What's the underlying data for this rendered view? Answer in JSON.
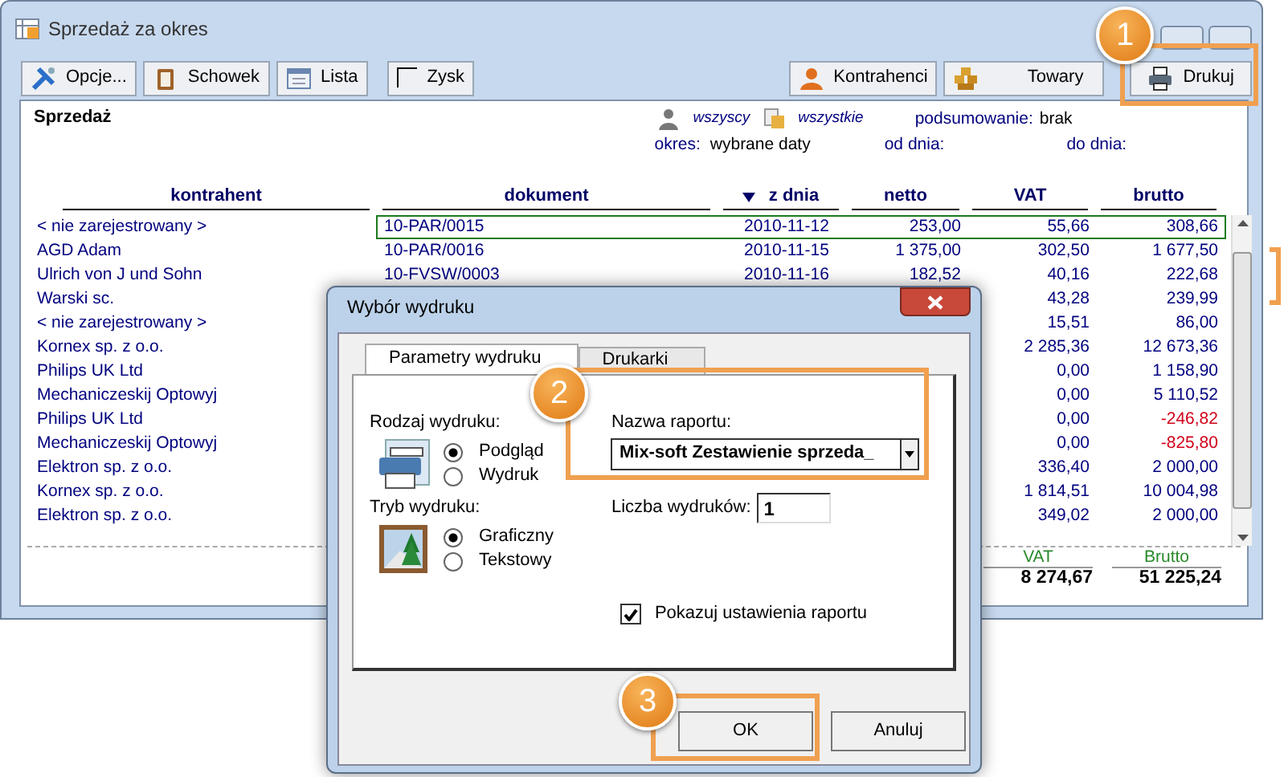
{
  "window": {
    "title": "Sprzedaż za okres"
  },
  "toolbar": {
    "left": [
      {
        "label": "Opcje..."
      },
      {
        "label": "Schowek"
      },
      {
        "label": "Lista"
      }
    ],
    "profit_checkbox": {
      "label": "Zysk",
      "checked": false
    },
    "right": [
      {
        "label": "Kontrahenci"
      },
      {
        "label": "Towary"
      },
      {
        "label": "Drukuj"
      }
    ]
  },
  "report": {
    "title": "Sprzedaż",
    "customers": "wszyscy",
    "goods": "wszystkie",
    "summary_label": "podsumowanie:",
    "summary": "brak",
    "period_label": "okres:",
    "period": "wybrane daty",
    "from_label": "od dnia:",
    "to_label": "do dnia:"
  },
  "table": {
    "columns": [
      {
        "label": "kontrahent",
        "sorted": false
      },
      {
        "label": "dokument",
        "sorted": false
      },
      {
        "label": "z dnia",
        "sorted": true
      },
      {
        "label": "netto",
        "sorted": false
      },
      {
        "label": "VAT",
        "sorted": false
      },
      {
        "label": "brutto",
        "sorted": false
      }
    ],
    "rows": [
      {
        "kontrahent": "< nie zarejestrowany >",
        "dokument": "10-PAR/0015",
        "z_dnia": "2010-11-12",
        "netto": "253,00",
        "vat": "55,66",
        "brutto": "308,66",
        "selected": true,
        "negative": false
      },
      {
        "kontrahent": "AGD Adam",
        "dokument": "10-PAR/0016",
        "z_dnia": "2010-11-15",
        "netto": "1 375,00",
        "vat": "302,50",
        "brutto": "1 677,50",
        "selected": false,
        "negative": false
      },
      {
        "kontrahent": "Ulrich von J und Sohn",
        "dokument": "10-FVSW/0003",
        "z_dnia": "2010-11-16",
        "netto": "182,52",
        "vat": "40,16",
        "brutto": "222,68",
        "selected": false,
        "negative": false
      },
      {
        "kontrahent": "Warski sc.",
        "vat": "43,28",
        "brutto": "239,99",
        "selected": false,
        "negative": false
      },
      {
        "kontrahent": "< nie zarejestrowany >",
        "vat": "15,51",
        "brutto": "86,00",
        "selected": false,
        "negative": false
      },
      {
        "kontrahent": "Kornex sp. z o.o.",
        "vat": "2 285,36",
        "brutto": "12 673,36",
        "selected": false,
        "negative": false
      },
      {
        "kontrahent": "Philips UK Ltd",
        "vat": "0,00",
        "brutto": "1 158,90",
        "selected": false,
        "negative": false
      },
      {
        "kontrahent": "Mechaniczeskij Optowyj",
        "vat": "0,00",
        "brutto": "5 110,52",
        "selected": false,
        "negative": false
      },
      {
        "kontrahent": "Philips UK Ltd",
        "vat": "0,00",
        "brutto": "-246,82",
        "selected": false,
        "negative": true
      },
      {
        "kontrahent": "Mechaniczeskij Optowyj",
        "vat": "0,00",
        "brutto": "-825,80",
        "selected": false,
        "negative": true
      },
      {
        "kontrahent": "Elektron sp. z o.o.",
        "vat": "336,40",
        "brutto": "2 000,00",
        "selected": false,
        "negative": false
      },
      {
        "kontrahent": "Kornex sp. z o.o.",
        "vat": "1 814,51",
        "brutto": "10 004,98",
        "selected": false,
        "negative": false
      },
      {
        "kontrahent": "Elektron sp. z o.o.",
        "vat": "349,02",
        "brutto": "2 000,00",
        "selected": false,
        "negative": false
      }
    ],
    "totals": [
      {
        "label": "VAT",
        "value": "8 274,67"
      },
      {
        "label": "Brutto",
        "value": "51 225,24"
      }
    ]
  },
  "dialog": {
    "title": "Wybór wydruku",
    "tabs": [
      {
        "label": "Parametry wydruku",
        "selected": true
      },
      {
        "label": "Drukarki",
        "selected": false
      }
    ],
    "print_type": {
      "label": "Rodzaj wydruku:",
      "options": [
        {
          "label": "Podgląd",
          "selected": true
        },
        {
          "label": "Wydruk",
          "selected": false
        }
      ]
    },
    "print_mode": {
      "label": "Tryb wydruku:",
      "options": [
        {
          "label": "Graficzny",
          "selected": true
        },
        {
          "label": "Tekstowy",
          "selected": false
        }
      ]
    },
    "report_name": {
      "label": "Nazwa raportu:",
      "value": "Mix-soft Zestawienie sprzeda_"
    },
    "copies": {
      "label": "Liczba wydruków:",
      "value": "1"
    },
    "show_settings": {
      "label": "Pokazuj ustawienia raportu",
      "checked": true
    },
    "buttons": [
      {
        "label": "OK"
      },
      {
        "label": "Anuluj"
      }
    ]
  },
  "callouts": [
    {
      "label": "1"
    },
    {
      "label": "2"
    },
    {
      "label": "3"
    }
  ]
}
